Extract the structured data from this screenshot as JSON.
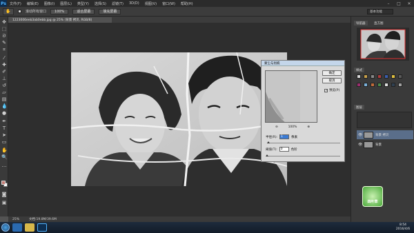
{
  "app": {
    "logo": "Ps"
  },
  "menu": [
    "文件(F)",
    "编辑(E)",
    "图像(I)",
    "图层(L)",
    "类型(Y)",
    "选择(S)",
    "滤镜(T)",
    "3D(D)",
    "视图(V)",
    "窗口(W)",
    "帮助(H)"
  ],
  "window_controls": [
    "minimize-icon",
    "restore-icon",
    "close-icon"
  ],
  "options_bar": {
    "checkbox_label": "滚动所有窗口",
    "btn_100": "100%",
    "btn_fit": "适合屏幕",
    "btn_fill": "填充屏幕",
    "workspace": "基本功能"
  },
  "document_tab": "1223006eeb3ab0ebb.jpg @ 25% (背景 拷贝, RGB/8)",
  "status": {
    "zoom": "25%",
    "doc": "文档:19.8M/39.6M"
  },
  "dialog": {
    "title": "蒙尘与划痕",
    "ok": "确定",
    "cancel": "取消",
    "preview_label": "预览(P)",
    "zoom_level": "100%",
    "radius_label": "半径(R):",
    "radius_value": "1",
    "radius_unit": "像素",
    "threshold_label": "阈值(T):",
    "threshold_value": "0",
    "threshold_unit": "色阶"
  },
  "panels": {
    "navigator_tab": "导航器",
    "histogram_tab": "直方图",
    "styles_tab": "样式",
    "layers_tab": "图层",
    "layers": [
      {
        "name": "背景 拷贝",
        "selected": true
      },
      {
        "name": "背景",
        "selected": false
      }
    ],
    "style_colors": [
      "#d8d8d8",
      "#c9a14a",
      "#8a8a8a",
      "#b23b3b",
      "#3a5fb0",
      "#e0c040",
      "#5a5a5a",
      "#9a2e6e",
      "#7ab0d8",
      "#c06a3a",
      "#4a8a4a",
      "#e0e0e0",
      "#304050",
      "#a0a0a0"
    ]
  },
  "taskbar": {
    "time": "8:54",
    "date": "2016/4/6"
  },
  "badge_text": "四叶草"
}
